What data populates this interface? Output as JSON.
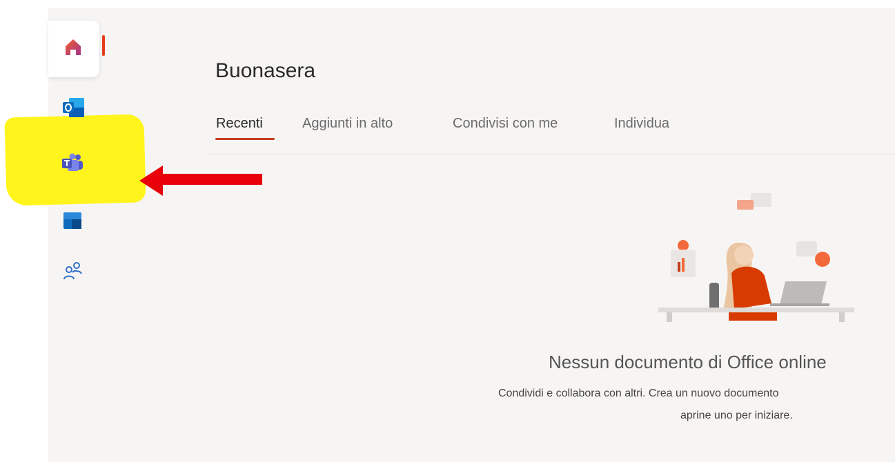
{
  "sidebar": {
    "items": [
      {
        "name": "home",
        "icon": "home-icon",
        "active": true
      },
      {
        "name": "outlook",
        "icon": "outlook-icon"
      },
      {
        "name": "teams",
        "icon": "teams-icon",
        "highlighted": true
      },
      {
        "name": "whiteboard",
        "icon": "whiteboard-icon"
      },
      {
        "name": "people",
        "icon": "people-icon"
      }
    ]
  },
  "main": {
    "greeting": "Buonasera",
    "tabs": [
      {
        "label": "Recenti",
        "active": true
      },
      {
        "label": "Aggiunti in alto"
      },
      {
        "label": "Condivisi con me"
      },
      {
        "label": "Individua"
      }
    ],
    "empty_state": {
      "title": "Nessun documento di Office online",
      "line1": "Condividi e collabora con altri. Crea un nuovo documento",
      "line2": "aprine uno per iniziare."
    }
  },
  "annotation": {
    "highlight_color": "#fff51c",
    "arrow_color": "#e8000b"
  },
  "colors": {
    "accent": "#c43e1c",
    "home_active_bar": "#e43b1a",
    "background": "#f7f5f3"
  }
}
